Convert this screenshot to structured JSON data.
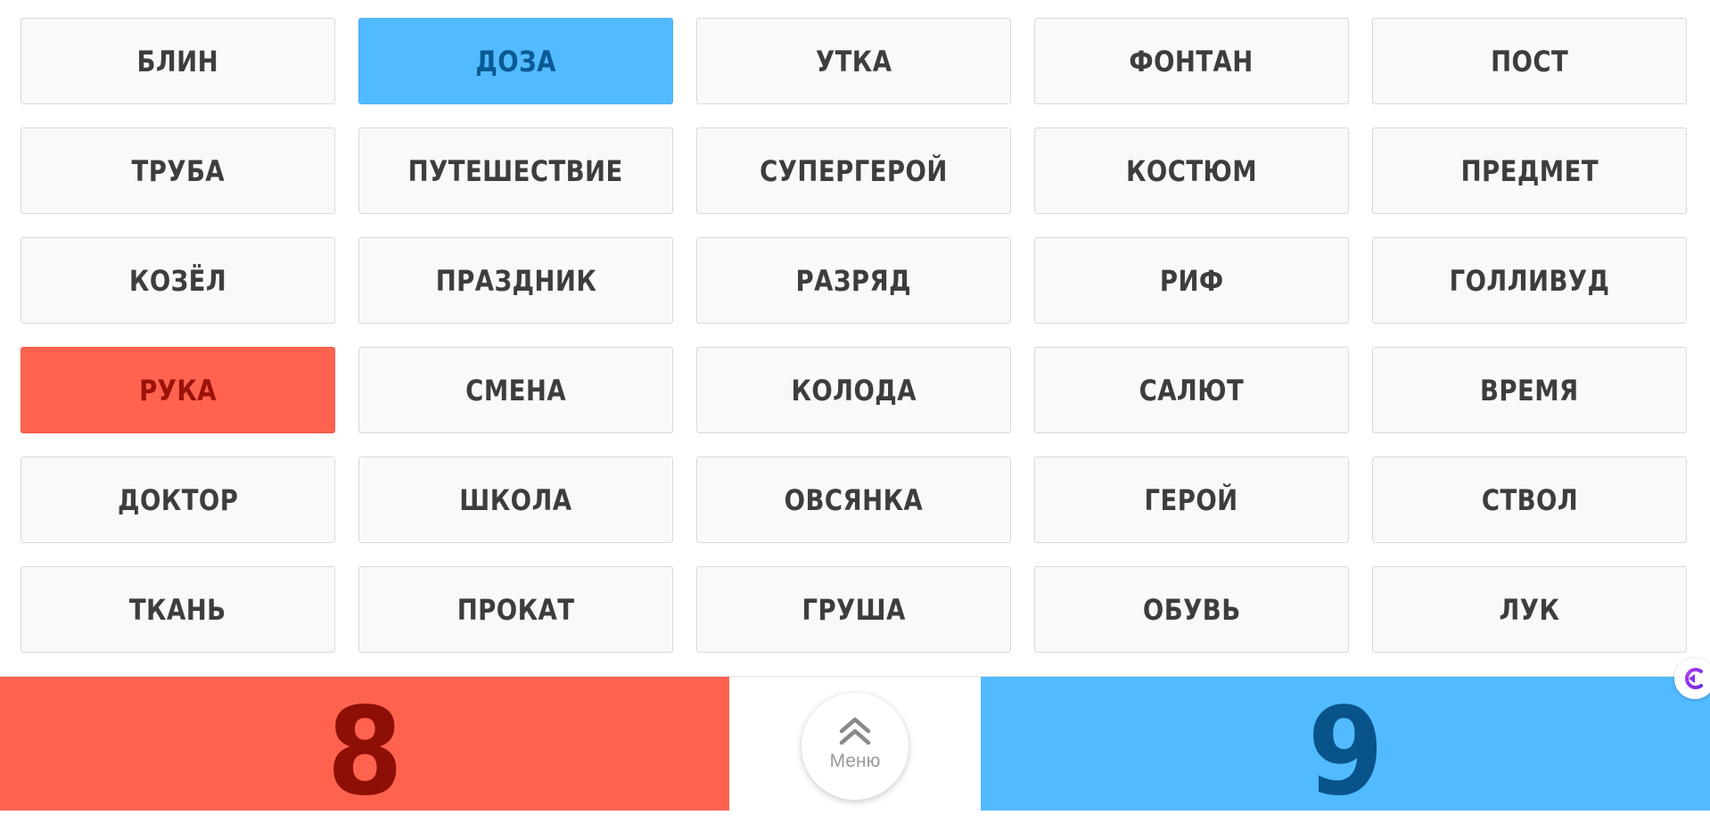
{
  "cards": [
    [
      "БЛИН",
      "ДОЗА",
      "УТКА",
      "ФОНТАН",
      "ПОСТ"
    ],
    [
      "ТРУБА",
      "ПУТЕШЕСТВИЕ",
      "СУПЕРГЕРОЙ",
      "КОСТЮМ",
      "ПРЕДМЕТ"
    ],
    [
      "КОЗЁЛ",
      "ПРАЗДНИК",
      "РАЗРЯД",
      "РИФ",
      "ГОЛЛИВУД"
    ],
    [
      "РУКА",
      "СМЕНА",
      "КОЛОДА",
      "САЛЮТ",
      "ВРЕМЯ"
    ],
    [
      "ДОКТОР",
      "ШКОЛА",
      "ОВСЯНКА",
      "ГЕРОЙ",
      "СТВОЛ"
    ],
    [
      "ТКАНЬ",
      "ПРОКАТ",
      "ГРУША",
      "ОБУВЬ",
      "ЛУК"
    ]
  ],
  "revealed": {
    "blue": [
      "ДОЗА"
    ],
    "red": [
      "РУКА"
    ]
  },
  "scores": {
    "red": "8",
    "blue": "9"
  },
  "menu": {
    "label": "Меню",
    "icon": "double-chevron-up-icon"
  },
  "side_widget": {
    "icon": "assistant-icon"
  },
  "colors": {
    "red_team": "#ff6350",
    "blue_team": "#52baff",
    "neutral_card": "#f9f9f9",
    "card_text": "#3d3d3d"
  }
}
